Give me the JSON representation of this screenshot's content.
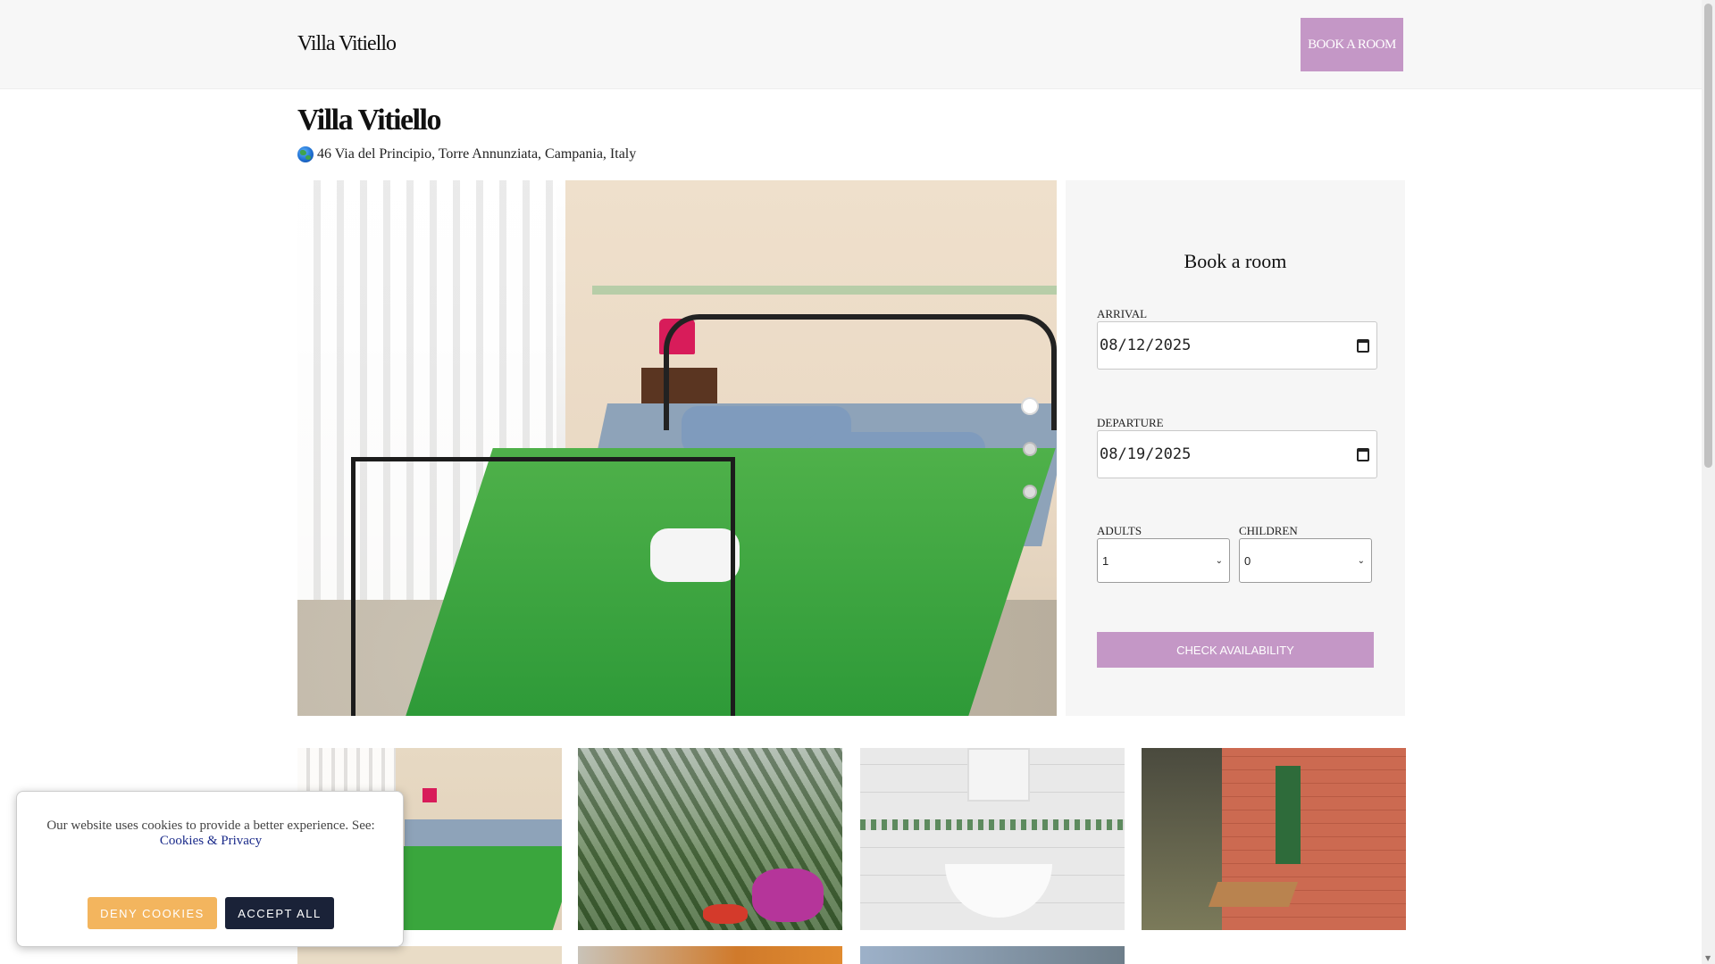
{
  "header": {
    "brand": "Villa Vitiello",
    "book_button": "BOOK A ROOM"
  },
  "property": {
    "name": "Villa Vitiello",
    "address": "46 Via del Principio, Torre Annunziata, Campania, Italy",
    "address_icon": "globe-icon"
  },
  "carousel": {
    "active_slide": 1,
    "slide_count": 3
  },
  "booking": {
    "title": "Book a room",
    "arrival_label": "ARRIVAL",
    "arrival_value": "08/12/2025",
    "departure_label": "DEPARTURE",
    "departure_value": "08/19/2025",
    "adults_label": "ADULTS",
    "adults_value": "1",
    "children_label": "CHILDREN",
    "children_value": "0",
    "check_button": "CHECK AVAILABILITY"
  },
  "cookie_banner": {
    "message": "Our website uses cookies to provide a better experience. See:",
    "link_text": "Cookies & Privacy",
    "deny_button": "DENY COOKIES",
    "accept_button": "ACCEPT ALL"
  },
  "colors": {
    "accent": "#c497c6",
    "deny": "#f3b55e",
    "accept": "#1a2238",
    "panel": "#f6f6f6"
  }
}
